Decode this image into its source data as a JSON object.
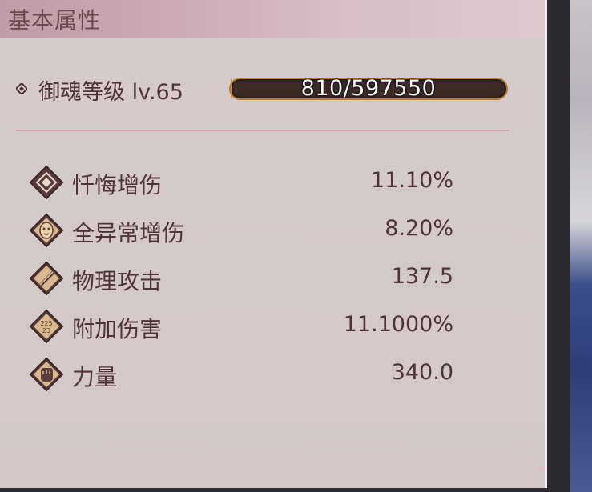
{
  "panel": {
    "title": "基本属性"
  },
  "level": {
    "label": "御魂等级 lv.65",
    "xp_text": "810/597550",
    "xp_progress": 0.00136
  },
  "stats": [
    {
      "name": "忏悔增伤",
      "value": "11.10%",
      "icon": "diamond-icon"
    },
    {
      "name": "全异常增伤",
      "value": "8.20%",
      "icon": "mask-face-icon"
    },
    {
      "name": "物理攻击",
      "value": "137.5",
      "icon": "blade-icon"
    },
    {
      "name": "附加伤害",
      "value": "11.1000%",
      "icon": "number-badge-icon",
      "icon_text": "225\n23"
    },
    {
      "name": "力量",
      "value": "340.0",
      "icon": "fist-icon"
    }
  ],
  "colors": {
    "text": "#4e3438",
    "panel_bg": "#d4c8c8",
    "header_bg": "#c9a7b2",
    "xp_border": "#b27a3a"
  }
}
